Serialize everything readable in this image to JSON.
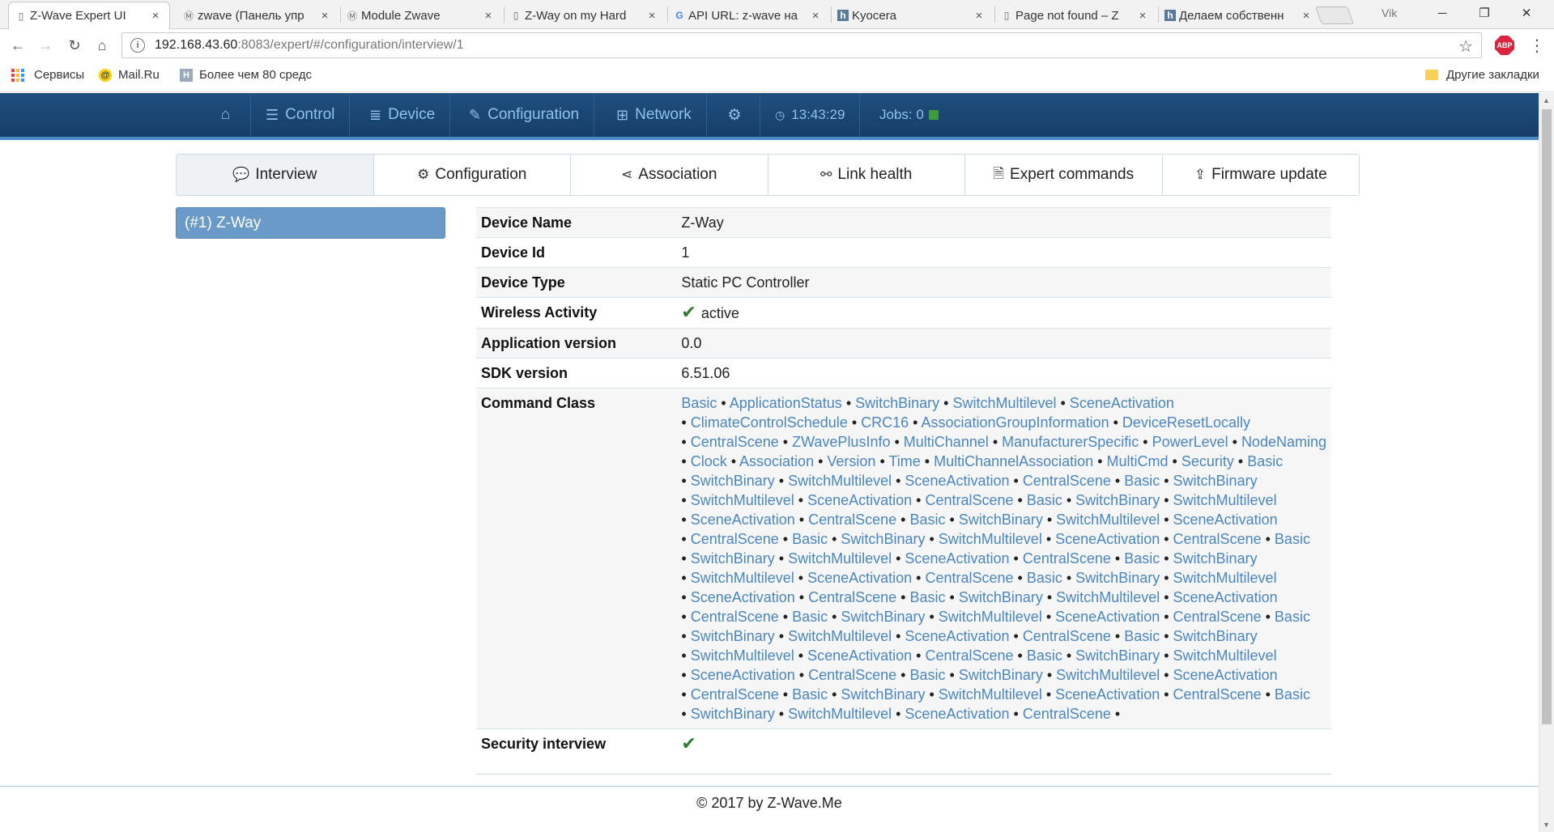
{
  "browser": {
    "tabs": [
      {
        "title": "Z-Wave Expert UI",
        "icon": "page-icon",
        "active": true
      },
      {
        "title": "zwave (Панель упр",
        "icon": "m-icon",
        "active": false
      },
      {
        "title": "Module Zwave",
        "icon": "m-icon",
        "active": false
      },
      {
        "title": "Z-Way on my Hard",
        "icon": "page-icon",
        "active": false
      },
      {
        "title": "API URL: z-wave на",
        "icon": "google-icon",
        "active": false
      },
      {
        "title": "Kyocera",
        "icon": "h-icon",
        "active": false
      },
      {
        "title": "Page not found – Z",
        "icon": "page-icon",
        "active": false
      },
      {
        "title": "Делаем собственн",
        "icon": "h-icon",
        "active": false
      }
    ],
    "tab_close": "×",
    "profile_label": "Vik",
    "url_host": "192.168.43.60",
    "url_rest": ":8083/expert/#/configuration/interview/1",
    "bookmarks": {
      "services": "Сервисы",
      "mail": "Mail.Ru",
      "more80": "Более чем 80 средс",
      "other": "Другие закладки"
    },
    "abp_label": "ABP"
  },
  "app_nav": {
    "control": "Control",
    "device": "Device",
    "configuration": "Configuration",
    "network": "Network",
    "time": "13:43:29",
    "jobs": "Jobs: 0"
  },
  "subtabs": {
    "interview": "Interview",
    "configuration": "Configuration",
    "association": "Association",
    "link_health": "Link health",
    "expert_commands": "Expert commands",
    "firmware_update": "Firmware update"
  },
  "device_list": [
    {
      "label": "(#1) Z-Way",
      "selected": true
    }
  ],
  "device_info": {
    "device_name_label": "Device Name",
    "device_name": "Z-Way",
    "device_id_label": "Device Id",
    "device_id": "1",
    "device_type_label": "Device Type",
    "device_type": "Static PC Controller",
    "wireless_label": "Wireless Activity",
    "wireless_status": "active",
    "app_version_label": "Application version",
    "app_version": "0.0",
    "sdk_version_label": "SDK version",
    "sdk_version": "6.51.06",
    "command_class_label": "Command Class",
    "command_class_lines": [
      [
        "Basic",
        "ApplicationStatus",
        "SwitchBinary",
        "SwitchMultilevel",
        "SceneActivation"
      ],
      [
        "ClimateControlSchedule",
        "CRC16",
        "AssociationGroupInformation",
        "DeviceResetLocally"
      ],
      [
        "CentralScene",
        "ZWavePlusInfo",
        "MultiChannel",
        "ManufacturerSpecific",
        "PowerLevel",
        "NodeNaming"
      ],
      [
        "Clock",
        "Association",
        "Version",
        "Time",
        "MultiChannelAssociation",
        "MultiCmd",
        "Security",
        "Basic"
      ],
      [
        "SwitchBinary",
        "SwitchMultilevel",
        "SceneActivation",
        "CentralScene",
        "Basic",
        "SwitchBinary"
      ],
      [
        "SwitchMultilevel",
        "SceneActivation",
        "CentralScene",
        "Basic",
        "SwitchBinary",
        "SwitchMultilevel"
      ],
      [
        "SceneActivation",
        "CentralScene",
        "Basic",
        "SwitchBinary",
        "SwitchMultilevel",
        "SceneActivation"
      ],
      [
        "CentralScene",
        "Basic",
        "SwitchBinary",
        "SwitchMultilevel",
        "SceneActivation",
        "CentralScene",
        "Basic"
      ],
      [
        "SwitchBinary",
        "SwitchMultilevel",
        "SceneActivation",
        "CentralScene",
        "Basic",
        "SwitchBinary"
      ],
      [
        "SwitchMultilevel",
        "SceneActivation",
        "CentralScene",
        "Basic",
        "SwitchBinary",
        "SwitchMultilevel"
      ],
      [
        "SceneActivation",
        "CentralScene",
        "Basic",
        "SwitchBinary",
        "SwitchMultilevel",
        "SceneActivation"
      ],
      [
        "CentralScene",
        "Basic",
        "SwitchBinary",
        "SwitchMultilevel",
        "SceneActivation",
        "CentralScene",
        "Basic"
      ],
      [
        "SwitchBinary",
        "SwitchMultilevel",
        "SceneActivation",
        "CentralScene",
        "Basic",
        "SwitchBinary"
      ],
      [
        "SwitchMultilevel",
        "SceneActivation",
        "CentralScene",
        "Basic",
        "SwitchBinary",
        "SwitchMultilevel"
      ],
      [
        "SceneActivation",
        "CentralScene",
        "Basic",
        "SwitchBinary",
        "SwitchMultilevel",
        "SceneActivation"
      ],
      [
        "CentralScene",
        "Basic",
        "SwitchBinary",
        "SwitchMultilevel",
        "SceneActivation",
        "CentralScene",
        "Basic"
      ],
      [
        "SwitchBinary",
        "SwitchMultilevel",
        "SceneActivation",
        "CentralScene"
      ]
    ],
    "security_interview_label": "Security interview"
  },
  "footer": "© 2017 by Z-Wave.Me",
  "colors": {
    "nav_bg": "#1f4f7f",
    "nav_text": "#8fc1ec",
    "link": "#4a86c0",
    "selected_device": "#6a9bc8",
    "check": "#2e7d32",
    "jobs_led": "#3d9a3d"
  }
}
